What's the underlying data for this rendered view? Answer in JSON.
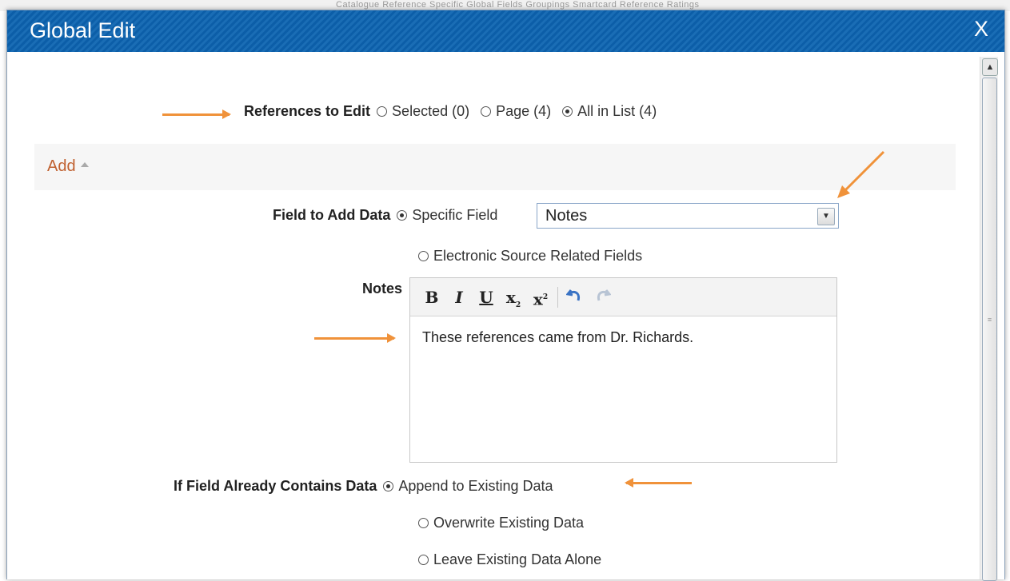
{
  "background": {
    "tabs_text": "Catalogue   Reference Specific   Global Fields   Groupings   Smartcard   Reference   Ratings"
  },
  "dialog": {
    "title": "Global Edit",
    "close_label": "X"
  },
  "references_to_edit": {
    "label": "References to Edit",
    "options": [
      {
        "label": "Selected (0)",
        "selected": false
      },
      {
        "label": "Page (4)",
        "selected": false
      },
      {
        "label": "All in List (4)",
        "selected": true
      }
    ]
  },
  "section": {
    "label": "Add"
  },
  "field_to_add": {
    "label": "Field to Add Data",
    "option_specific": "Specific Field",
    "option_electronic": "Electronic Source Related Fields",
    "selected_field": "Notes"
  },
  "notes": {
    "label": "Notes",
    "toolbar": [
      "bold",
      "italic",
      "underline",
      "subscript",
      "superscript",
      "undo",
      "redo"
    ],
    "text": "These references came from Dr. Richards."
  },
  "existing_data": {
    "label": "If Field Already Contains Data",
    "options": [
      {
        "label": "Append to Existing Data",
        "selected": true
      },
      {
        "label": "Overwrite Existing Data",
        "selected": false
      },
      {
        "label": "Leave Existing Data Alone",
        "selected": false
      }
    ]
  },
  "colors": {
    "titlebar": "#0c5ea8",
    "accent_arrow": "#f0923a",
    "add_link": "#c0602f"
  }
}
